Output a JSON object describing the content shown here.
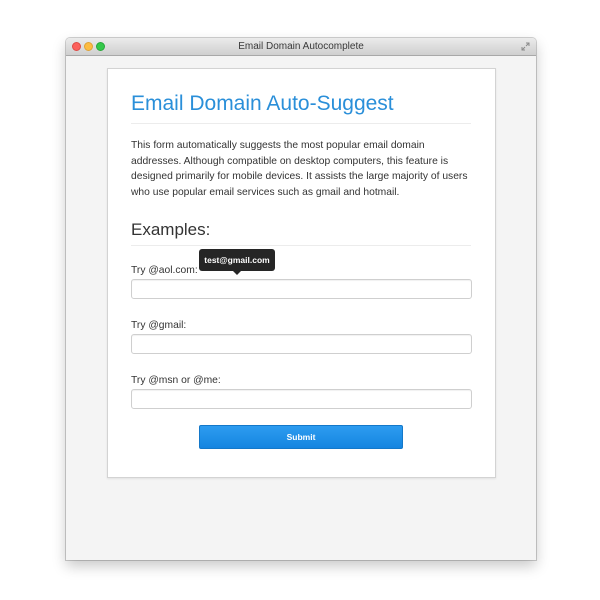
{
  "window": {
    "title": "Email Domain Autocomplete"
  },
  "page": {
    "title": "Email Domain Auto-Suggest",
    "description": "This form automatically suggests the most popular email domain addresses. Although compatible on desktop computers, this feature is designed primarily for mobile devices. It assists the large majority of users who use popular email services such as gmail and hotmail.",
    "examples_heading": "Examples:"
  },
  "fields": [
    {
      "label": "Try @aol.com:",
      "value": "",
      "placeholder": ""
    },
    {
      "label": "Try @gmail:",
      "value": "",
      "placeholder": ""
    },
    {
      "label": "Try @msn or @me:",
      "value": "",
      "placeholder": ""
    }
  ],
  "tooltip": {
    "text": "test@gmail.com"
  },
  "submit": {
    "label": "Submit"
  },
  "colors": {
    "accent": "#2a8fd9",
    "button": "#1e90ec",
    "tooltip_bg": "#262626"
  }
}
